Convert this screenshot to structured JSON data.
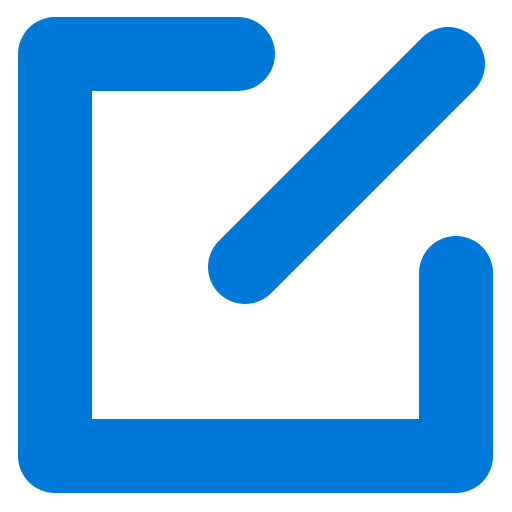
{
  "icon": {
    "name": "edit-icon",
    "color": "#0078d7",
    "background": "#ffffff"
  }
}
